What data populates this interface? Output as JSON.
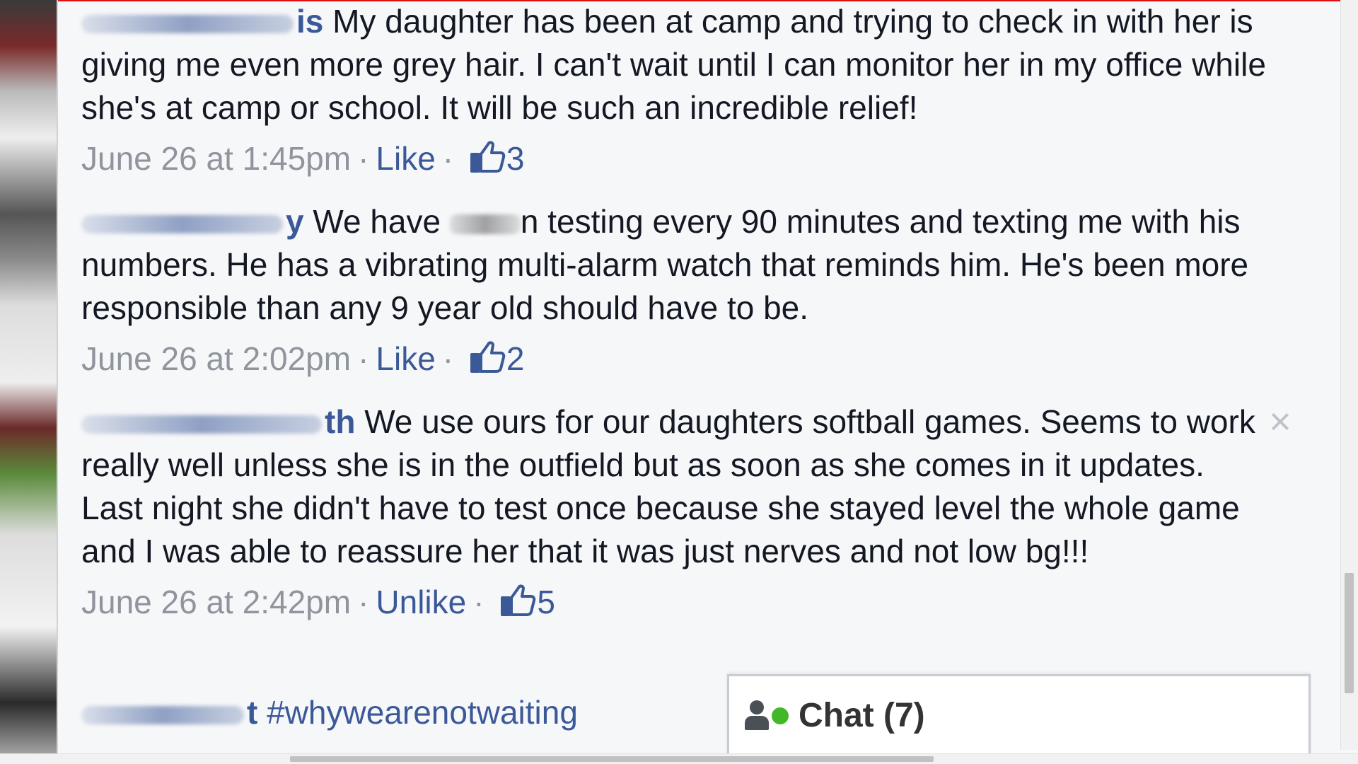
{
  "comments": [
    {
      "author_visible": "is",
      "text": "My daughter has been at camp and trying to check in with her is giving me even more grey hair. I can't wait until I can monitor her in my office while she's at camp or school. It will be such an incredible relief!",
      "timestamp": "June 26 at 1:45pm",
      "action": "Like",
      "likes": "3"
    },
    {
      "author_visible": "y",
      "text_before": "We have",
      "text_after": "n testing every 90 minutes and texting me with his numbers. He has a vibrating multi-alarm watch that reminds him. He's been more responsible than any 9 year old should have to be.",
      "timestamp": "June 26 at 2:02pm",
      "action": "Like",
      "likes": "2"
    },
    {
      "author_visible": "th",
      "text": "We use ours for our daughters softball games. Seems to work really well unless she is in the outfield but as soon as she comes in it updates. Last night she didn't have to test once because she stayed level the whole game and I was able to reassure her that it was just nerves and not low bg!!!",
      "timestamp": "June 26 at 2:42pm",
      "action": "Unlike",
      "likes": "5"
    },
    {
      "author_visible": "t",
      "text": "#whywearenotwaiting"
    }
  ],
  "separator": "·",
  "close_glyph": "×",
  "chat": {
    "label": "Chat (7)"
  },
  "colors": {
    "link": "#3b5998",
    "meta": "#90949c",
    "online": "#42b72a"
  },
  "icons": {
    "like": "thumbs-up-icon",
    "close": "close-icon",
    "chat": "person-icon"
  }
}
